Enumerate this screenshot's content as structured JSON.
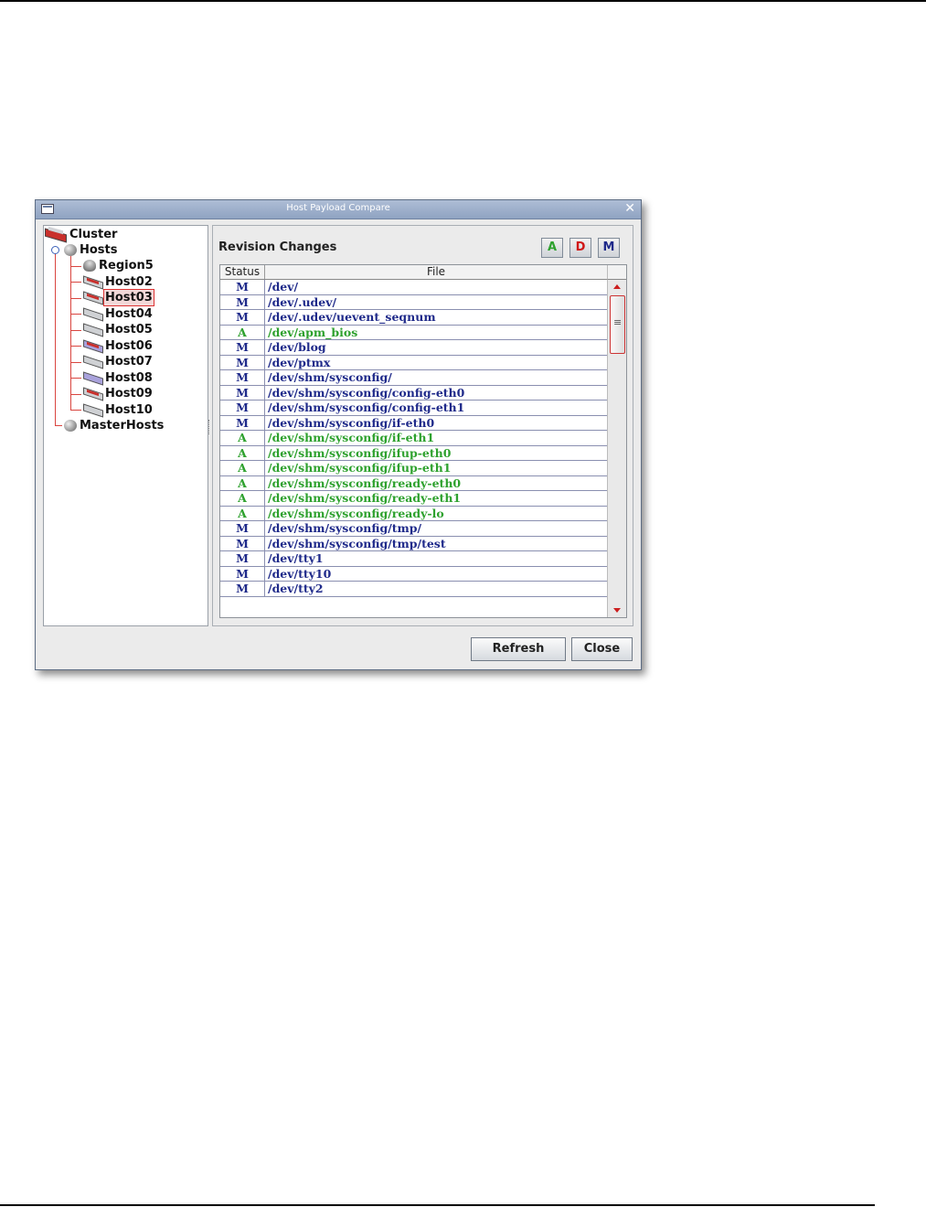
{
  "window": {
    "title": "Host Payload Compare",
    "close_glyph": "✕"
  },
  "tree": {
    "root": "Cluster",
    "hosts_group": "Hosts",
    "nodes": [
      {
        "label": "Region5",
        "icon": "region-icon"
      },
      {
        "label": "Host02",
        "icon": "host-icon"
      },
      {
        "label": "Host03",
        "icon": "host-icon",
        "selected": true
      },
      {
        "label": "Host04",
        "icon": "host-icon"
      },
      {
        "label": "Host05",
        "icon": "host-icon"
      },
      {
        "label": "Host06",
        "icon": "host-icon"
      },
      {
        "label": "Host07",
        "icon": "host-icon"
      },
      {
        "label": "Host08",
        "icon": "host-icon"
      },
      {
        "label": "Host09",
        "icon": "host-icon"
      },
      {
        "label": "Host10",
        "icon": "host-icon"
      }
    ],
    "masterhosts_group": "MasterHosts"
  },
  "revision": {
    "title": "Revision Changes",
    "filters": [
      {
        "label": "A",
        "color": "#2ea12e"
      },
      {
        "label": "D",
        "color": "#d01818"
      },
      {
        "label": "M",
        "color": "#1f2a8a"
      }
    ],
    "columns": {
      "status": "Status",
      "file": "File"
    },
    "rows": [
      {
        "status": "M",
        "file": "/dev/"
      },
      {
        "status": "M",
        "file": "/dev/.udev/"
      },
      {
        "status": "M",
        "file": "/dev/.udev/uevent_seqnum"
      },
      {
        "status": "A",
        "file": "/dev/apm_bios"
      },
      {
        "status": "M",
        "file": "/dev/blog"
      },
      {
        "status": "M",
        "file": "/dev/ptmx"
      },
      {
        "status": "M",
        "file": "/dev/shm/sysconfig/"
      },
      {
        "status": "M",
        "file": "/dev/shm/sysconfig/config-eth0"
      },
      {
        "status": "M",
        "file": "/dev/shm/sysconfig/config-eth1"
      },
      {
        "status": "M",
        "file": "/dev/shm/sysconfig/if-eth0"
      },
      {
        "status": "A",
        "file": "/dev/shm/sysconfig/if-eth1"
      },
      {
        "status": "A",
        "file": "/dev/shm/sysconfig/ifup-eth0"
      },
      {
        "status": "A",
        "file": "/dev/shm/sysconfig/ifup-eth1"
      },
      {
        "status": "A",
        "file": "/dev/shm/sysconfig/ready-eth0"
      },
      {
        "status": "A",
        "file": "/dev/shm/sysconfig/ready-eth1"
      },
      {
        "status": "A",
        "file": "/dev/shm/sysconfig/ready-lo"
      },
      {
        "status": "M",
        "file": "/dev/shm/sysconfig/tmp/"
      },
      {
        "status": "M",
        "file": "/dev/shm/sysconfig/tmp/test"
      },
      {
        "status": "M",
        "file": "/dev/tty1"
      },
      {
        "status": "M",
        "file": "/dev/tty10"
      },
      {
        "status": "M",
        "file": "/dev/tty2"
      }
    ]
  },
  "buttons": {
    "refresh": "Refresh",
    "close": "Close"
  }
}
